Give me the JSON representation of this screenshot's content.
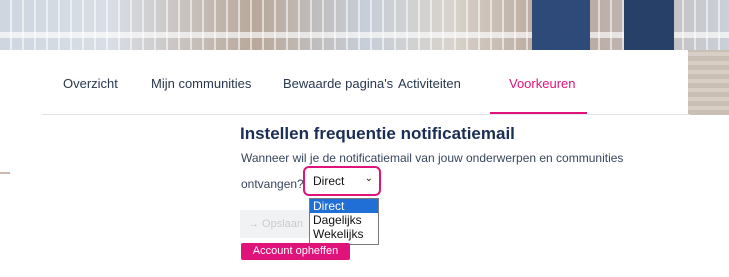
{
  "tabs": [
    {
      "label": "Overzicht"
    },
    {
      "label": "Mijn communities"
    },
    {
      "label": "Bewaarde pagina's"
    },
    {
      "label": "Activiteiten"
    },
    {
      "label": "Voorkeuren"
    }
  ],
  "active_tab": "Voorkeuren",
  "section": {
    "title": "Instellen frequentie notificatiemail",
    "description_line1": "Wanneer wil je de notificatiemail van jouw onderwerpen en communities",
    "description_line2": "ontvangen?"
  },
  "frequency_select": {
    "value": "Direct",
    "options": [
      "Direct",
      "Dagelijks",
      "Wekelijks"
    ]
  },
  "buttons": {
    "save_label": "→  Opslaan",
    "delete_account_label": "Account opheffen"
  },
  "colors": {
    "accent": "#e0137b",
    "heading": "#1b2e55",
    "option_highlight": "#1f6fd6"
  },
  "icons": {
    "select_chevron": "chevron-down-icon",
    "save_arrow": "arrow-right-icon"
  }
}
